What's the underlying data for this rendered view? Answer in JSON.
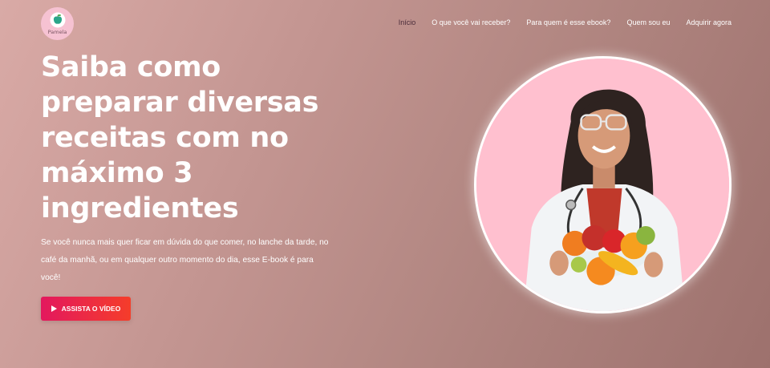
{
  "brand": {
    "logo_text": "Pamela"
  },
  "nav": {
    "items": [
      {
        "label": "Início",
        "active": true
      },
      {
        "label": "O que você vai receber?",
        "active": false
      },
      {
        "label": "Para quem é esse ebook?",
        "active": false
      },
      {
        "label": "Quem sou eu",
        "active": false
      },
      {
        "label": "Adquirir agora",
        "active": false
      }
    ]
  },
  "hero": {
    "title": "Saiba como preparar diversas receitas com no máximo 3 ingredientes",
    "subtitle": "Se você nunca mais quer ficar em dúvida do que comer, no lanche da tarde, no café da manhã, ou em qualquer outro momento do dia, esse E-book é para você!",
    "cta_label": "ASSISTA O VÍDEO",
    "cta_icon": "play-icon"
  },
  "colors": {
    "background_start": "#d9aaa6",
    "background_end": "#9d716d",
    "cta_start": "#e3185e",
    "cta_end": "#f53d2a",
    "portrait_bg": "#ffc0cf",
    "active_nav": "#4a2c3a"
  }
}
